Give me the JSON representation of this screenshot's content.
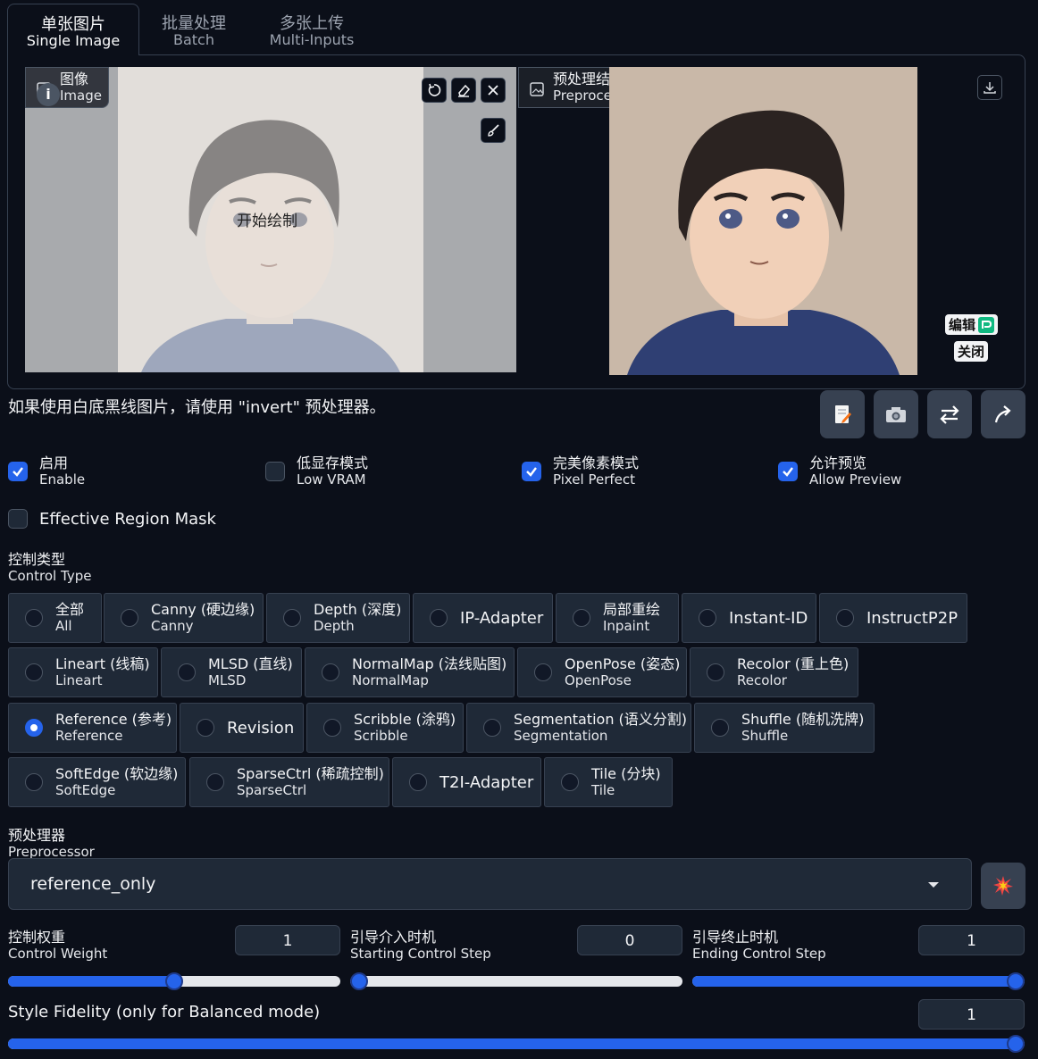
{
  "tabs": [
    {
      "zh": "单张图片",
      "en": "Single Image"
    },
    {
      "zh": "批量处理",
      "en": "Batch"
    },
    {
      "zh": "多张上传",
      "en": "Multi-Inputs"
    }
  ],
  "image_panel": {
    "label_zh": "图像",
    "label_en": "Image",
    "draw_hint": "开始绘制"
  },
  "preview_panel": {
    "label_zh": "预处理结果预览",
    "label_en": "Preprocessor Preview",
    "edit_label": "编辑",
    "close_label": "关闭"
  },
  "hint_text": "如果使用白底黑线图片，请使用 \"invert\" 预处理器。",
  "options": [
    {
      "zh": "启用",
      "en": "Enable",
      "checked": true
    },
    {
      "zh": "低显存模式",
      "en": "Low VRAM",
      "checked": false
    },
    {
      "zh": "完美像素模式",
      "en": "Pixel Perfect",
      "checked": true
    },
    {
      "zh": "允许预览",
      "en": "Allow Preview",
      "checked": true
    }
  ],
  "region_mask": {
    "label": "Effective Region Mask",
    "checked": false
  },
  "control_type": {
    "label_zh": "控制类型",
    "label_en": "Control Type",
    "selected": "Reference",
    "items": [
      {
        "zh": "全部",
        "en": "All"
      },
      {
        "zh": "Canny (硬边缘)",
        "en": "Canny"
      },
      {
        "zh": "Depth (深度)",
        "en": "Depth"
      },
      {
        "single": "IP-Adapter"
      },
      {
        "zh": "局部重绘",
        "en": "Inpaint"
      },
      {
        "single": "Instant-ID"
      },
      {
        "single": "InstructP2P"
      },
      {
        "zh": "Lineart (线稿)",
        "en": "Lineart"
      },
      {
        "zh": "MLSD (直线)",
        "en": "MLSD"
      },
      {
        "zh": "NormalMap (法线贴图)",
        "en": "NormalMap"
      },
      {
        "zh": "OpenPose (姿态)",
        "en": "OpenPose"
      },
      {
        "zh": "Recolor (重上色)",
        "en": "Recolor"
      },
      {
        "zh": "Reference (参考)",
        "en": "Reference"
      },
      {
        "single": "Revision"
      },
      {
        "zh": "Scribble (涂鸦)",
        "en": "Scribble"
      },
      {
        "zh": "Segmentation (语义分割)",
        "en": "Segmentation"
      },
      {
        "zh": "Shuffle (随机洗牌)",
        "en": "Shuffle"
      },
      {
        "zh": "SoftEdge (软边缘)",
        "en": "SoftEdge"
      },
      {
        "zh": "SparseCtrl (稀疏控制)",
        "en": "SparseCtrl"
      },
      {
        "single": "T2I-Adapter"
      },
      {
        "zh": "Tile (分块)",
        "en": "Tile"
      }
    ]
  },
  "preprocessor": {
    "label_zh": "预处理器",
    "label_en": "Preprocessor",
    "value": "reference_only"
  },
  "sliders": {
    "weight": {
      "label_zh": "控制权重",
      "label_en": "Control Weight",
      "value": "1",
      "fraction": 0.5
    },
    "start": {
      "label_zh": "引导介入时机",
      "label_en": "Starting Control Step",
      "value": "0",
      "fraction": 0.0
    },
    "end": {
      "label_zh": "引导终止时机",
      "label_en": "Ending Control Step",
      "value": "1",
      "fraction": 1.0
    },
    "fidelity": {
      "label": "Style Fidelity (only for Balanced mode)",
      "value": "1",
      "fraction": 1.0
    }
  },
  "colors": {
    "background": "#0b0f19",
    "accent": "#2563eb",
    "panel": "#1f2937",
    "border": "#374151"
  },
  "icons": [
    "image-icon",
    "undo-icon",
    "eraser-icon",
    "close-icon",
    "brush-icon",
    "download-icon",
    "edit-icon",
    "notes-icon",
    "camera-icon",
    "swap-icon",
    "send-icon",
    "explosion-icon",
    "chevron-down-icon",
    "check-icon"
  ]
}
